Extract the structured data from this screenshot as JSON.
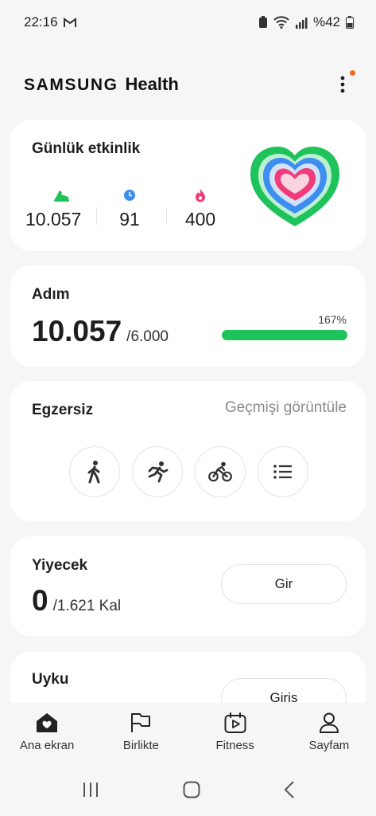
{
  "status": {
    "time": "22:16",
    "battery": "%42"
  },
  "app": {
    "brand": "SAMSUNG",
    "name": "Health"
  },
  "activity": {
    "title": "Günlük etkinlik",
    "steps": "10.057",
    "minutes": "91",
    "calories": "400",
    "colors": {
      "steps": "#1ec35c",
      "minutes": "#3d8ef0",
      "calories": "#ef3b7a"
    }
  },
  "steps": {
    "title": "Adım",
    "value": "10.057",
    "goal": "/6.000",
    "percent_label": "167%",
    "progress": 1.0
  },
  "exercise": {
    "title": "Egzersiz",
    "history_link": "Geçmişi görüntüle",
    "buttons": [
      "walking-icon",
      "running-icon",
      "cycling-icon",
      "list-icon"
    ]
  },
  "food": {
    "title": "Yiyecek",
    "value": "0",
    "goal": "/1.621 Kal",
    "button": "Gir"
  },
  "sleep": {
    "title": "Uyku",
    "button": "Giris"
  },
  "nav": {
    "home": "Ana ekran",
    "together": "Birlikte",
    "fitness": "Fitness",
    "profile": "Sayfam"
  }
}
